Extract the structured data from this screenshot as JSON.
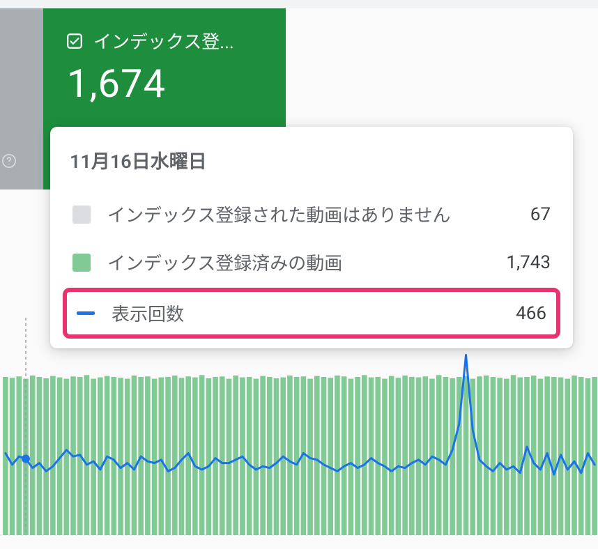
{
  "card": {
    "label": "インデックス登...",
    "value": "1,674"
  },
  "tooltip": {
    "date": "11月16日水曜日",
    "items": [
      {
        "swatch": "gray",
        "label": "インデックス登録された動画はありません",
        "value": "67"
      },
      {
        "swatch": "green",
        "label": "インデックス登録済みの動画",
        "value": "1,743"
      },
      {
        "swatch": "line",
        "label": "表示回数",
        "value": "466",
        "highlighted": true
      }
    ]
  },
  "chart_data": {
    "type": "bar+line",
    "title": "",
    "xlabel": "",
    "ylabel": "",
    "ylim_bars": [
      0,
      2000
    ],
    "ylim_line": [
      0,
      1200
    ],
    "categories_count": 88,
    "series": [
      {
        "name": "インデックス登録済みの動画",
        "type": "bar",
        "values": [
          1720,
          1710,
          1725,
          1700,
          1735,
          1720,
          1705,
          1730,
          1715,
          1700,
          1725,
          1720,
          1740,
          1700,
          1715,
          1730,
          1720,
          1710,
          1700,
          1735,
          1720,
          1725,
          1700,
          1715,
          1720,
          1735,
          1710,
          1725,
          1715,
          1740,
          1705,
          1720,
          1725,
          1700,
          1735,
          1715,
          1720,
          1700,
          1730,
          1720,
          1705,
          1715,
          1735,
          1720,
          1725,
          1700,
          1730,
          1720,
          1710,
          1735,
          1725,
          1700,
          1720,
          1740,
          1715,
          1720,
          1700,
          1730,
          1710,
          1735,
          1720,
          1715,
          1725,
          1700,
          1740,
          1720,
          1705,
          1720,
          1730,
          1700,
          1725,
          1735,
          1720,
          1710,
          1700,
          1740,
          1715,
          1720,
          1735,
          1700,
          1725,
          1720,
          1715,
          1700,
          1735,
          1720,
          1705,
          1720
        ]
      },
      {
        "name": "表示回数",
        "type": "line",
        "values": [
          500,
          430,
          480,
          466,
          410,
          440,
          390,
          420,
          470,
          520,
          480,
          490,
          430,
          450,
          400,
          480,
          460,
          410,
          440,
          400,
          480,
          450,
          440,
          460,
          390,
          410,
          460,
          500,
          420,
          400,
          420,
          470,
          440,
          440,
          460,
          480,
          430,
          400,
          420,
          410,
          440,
          480,
          450,
          430,
          500,
          470,
          460,
          430,
          410,
          390,
          420,
          440,
          410,
          430,
          470,
          440,
          420,
          390,
          420,
          410,
          440,
          460,
          430,
          480,
          460,
          430,
          520,
          680,
          1100,
          640,
          460,
          420,
          390,
          440,
          400,
          420,
          380,
          540,
          440,
          400,
          500,
          370,
          490,
          400,
          450,
          380,
          500,
          430
        ]
      }
    ],
    "highlight_index": 3
  },
  "colors": {
    "brand_green": "#1e8e3e",
    "bar_green": "#81c995",
    "line_blue": "#1a73e8",
    "highlight_pink": "#e73370",
    "gray": "#dadce0"
  }
}
